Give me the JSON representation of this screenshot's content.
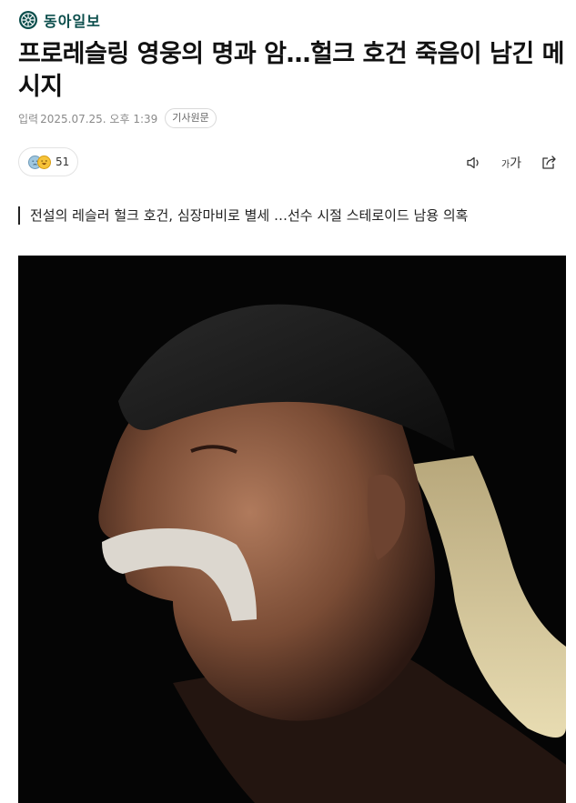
{
  "brand": {
    "name": "동아일보",
    "emblem_icon": "dongailbo-emblem-icon",
    "color": "#0a4d4b"
  },
  "article": {
    "headline": "프로레슬링 영웅의 명과 암…헐크 호건 죽음이 남긴 메시지",
    "meta": {
      "published_label": "입력",
      "published_at": "2025.07.25. 오후 1:39",
      "original_link_label": "기사원문"
    },
    "subheadline": "전설의 레슬러 헐크 호건, 심장마비로 별세 …선수 시절 스테로이드 남용 의혹"
  },
  "reactions": {
    "icons": [
      "sad-face-icon",
      "laughing-face-icon"
    ],
    "count": "51"
  },
  "toolbar": {
    "tts_icon": "speaker-icon",
    "font_size_label_small": "가",
    "font_size_label_large": "가",
    "share_icon": "share-icon"
  },
  "photo": {
    "subject": "profile-portrait"
  }
}
